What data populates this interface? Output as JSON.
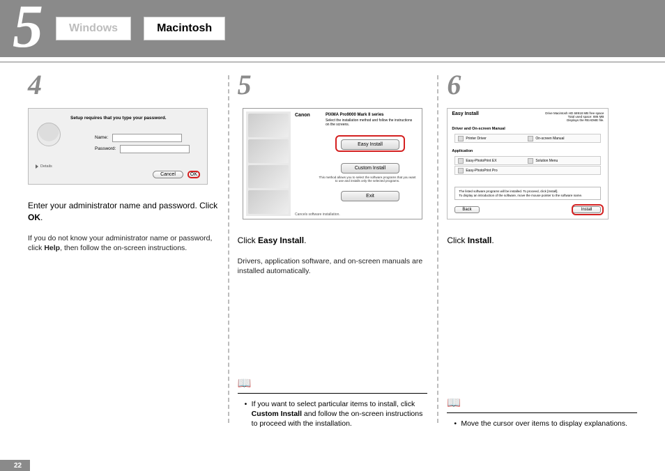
{
  "header": {
    "section_number": "5",
    "tab_windows": "Windows",
    "tab_macintosh": "Macintosh"
  },
  "steps": {
    "s4": {
      "num": "4",
      "dialog": {
        "message": "Setup requires that you type your password.",
        "name_label": "Name:",
        "password_label": "Password:",
        "details": "Details",
        "cancel": "Cancel",
        "ok": "OK"
      },
      "instruction_pre": "Enter your administrator name and password. Click ",
      "instruction_bold": "OK",
      "instruction_post": ".",
      "sub_pre": "If you do not know your administrator name or password, click ",
      "sub_bold": "Help",
      "sub_post": ", then follow the on-screen instructions."
    },
    "s5": {
      "num": "5",
      "dialog": {
        "brand": "Canon",
        "product": "PIXMA Pro9000 Mark II series",
        "intro": "Select the installation method and follow the instructions on the screens.",
        "easy": "Easy Install",
        "custom": "Custom Install",
        "exit": "Exit",
        "method_note": "This method allows you to select the software programs that you want to use and installs only the selected programs.",
        "footer": "Cancels software installation."
      },
      "instruction_pre": "Click ",
      "instruction_bold": "Easy Install",
      "instruction_post": ".",
      "sub": "Drivers, application software, and on-screen manuals are installed automatically.",
      "note_pre": "If you want to select particular items to install, click ",
      "note_bold": "Custom Install",
      "note_post": " and follow the on-screen instructions to proceed with the installation."
    },
    "s6": {
      "num": "6",
      "dialog": {
        "title": "Easy Install",
        "meta1": "Drive Macintosh HD 68918 MB free space",
        "meta2": "Total used space: 886 MB",
        "meta3": "Displays the README file.",
        "section1": "Driver and On-screen Manual",
        "section2": "Application",
        "row_printer_driver": "Printer Driver",
        "row_onscreen_manual": "On-screen Manual",
        "row_epp_ex": "Easy-PhotoPrint EX",
        "row_solution_menu": "Solution Menu",
        "row_epp_pro": "Easy-PhotoPrint Pro",
        "msg1": "The listed software programs will be installed. To proceed, click [Install].",
        "msg2": "To display an introduction of the software, move the mouse pointer to the software name.",
        "back": "Back",
        "install": "Install"
      },
      "instruction_pre": "Click ",
      "instruction_bold": "Install",
      "instruction_post": ".",
      "note": "Move the cursor over items to display explanations."
    }
  },
  "page_number": "22"
}
